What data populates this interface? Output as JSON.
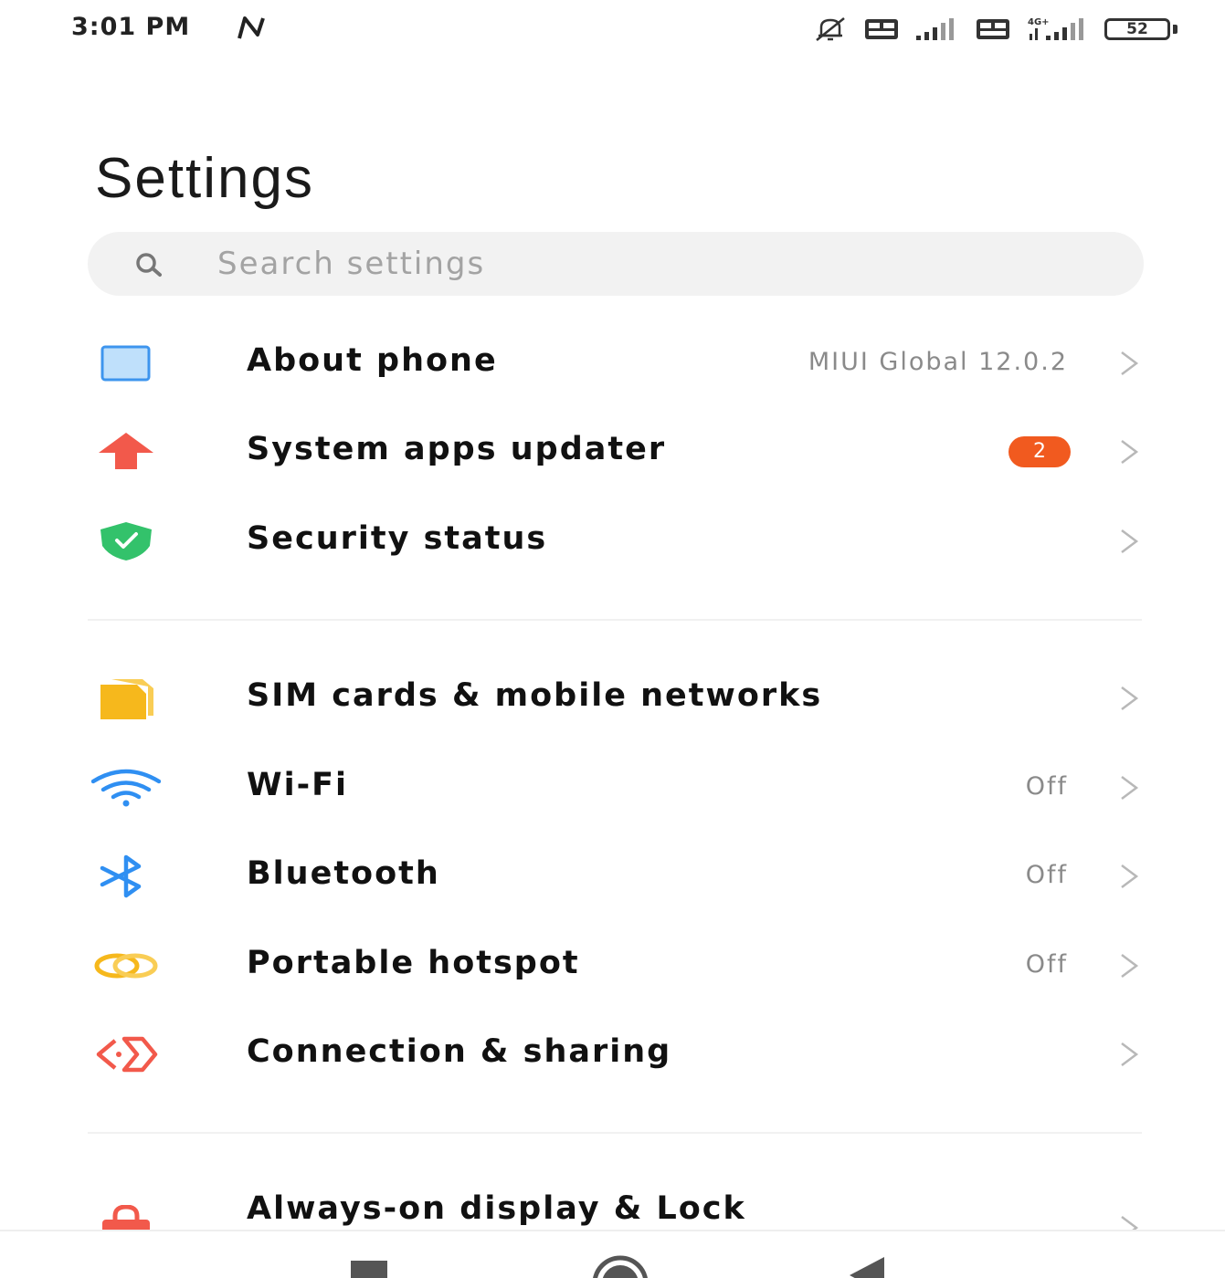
{
  "status_bar": {
    "time": "3:01 PM",
    "battery_level": "52",
    "icons": [
      "nfc-icon",
      "silent-bell-icon",
      "volte-icon",
      "signal-icon",
      "volte-icon",
      "4g-signal-icon",
      "battery-icon"
    ],
    "network_label": "4G+"
  },
  "page": {
    "title": "Settings"
  },
  "search": {
    "placeholder": "Search settings"
  },
  "items": [
    {
      "label": "About phone",
      "value": "MIUI Global 12.0.2",
      "icon": "phone-icon",
      "color": "#5aa7f5"
    },
    {
      "label": "System apps updater",
      "badge": "2",
      "icon": "upload-arrow-icon",
      "color": "#f2594b"
    },
    {
      "label": "Security status",
      "icon": "shield-check-icon",
      "color": "#33c26b"
    },
    {
      "label": "SIM cards & mobile networks",
      "icon": "sim-card-icon",
      "color": "#f6b81c"
    },
    {
      "label": "Wi-Fi",
      "value": "Off",
      "icon": "wifi-icon",
      "color": "#2f8ff2"
    },
    {
      "label": "Bluetooth",
      "value": "Off",
      "icon": "bluetooth-icon",
      "color": "#2f8ff2"
    },
    {
      "label": "Portable hotspot",
      "value": "Off",
      "icon": "hotspot-icon",
      "color": "#f6b81c"
    },
    {
      "label": "Connection & sharing",
      "icon": "connection-sharing-icon",
      "color": "#f2594b"
    },
    {
      "label": "Always-on display & Lock",
      "icon": "lock-icon",
      "color": "#f2594b"
    }
  ],
  "nav": {
    "icons": [
      "recents-square-icon",
      "home-circle-icon",
      "back-triangle-icon"
    ]
  },
  "colors": {
    "badge": "#f15a1f",
    "secondary_text": "#8a8a8a",
    "search_bg": "#f2f2f2"
  }
}
